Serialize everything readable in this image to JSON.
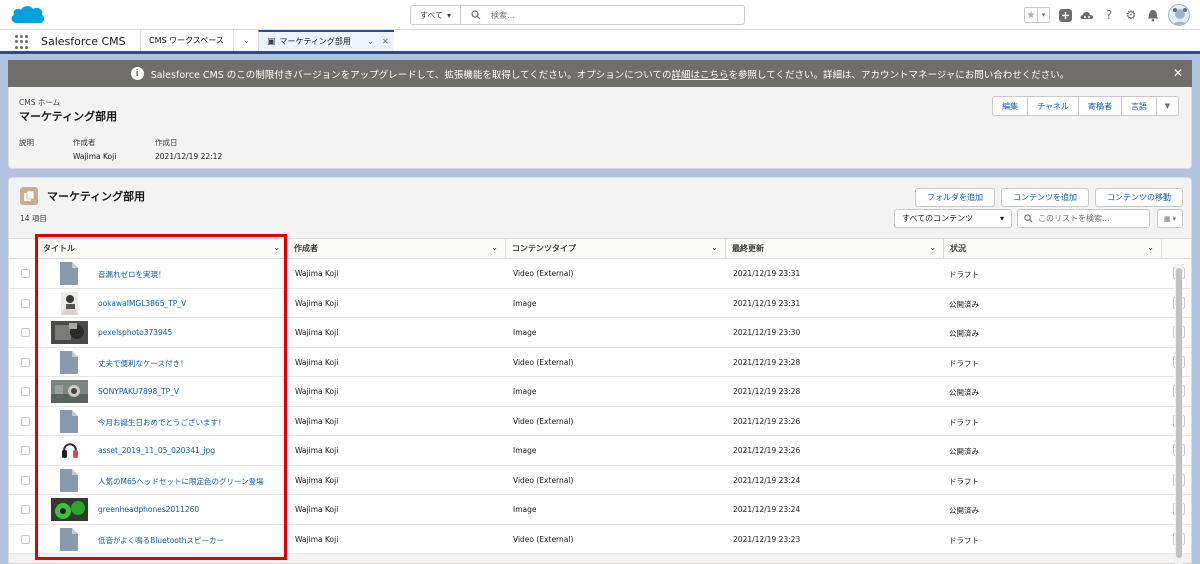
{
  "header": {
    "search_scope": "すべて",
    "search_placeholder": "検索...",
    "icons": [
      "favorites-star-icon",
      "add-icon",
      "trailhead-icon",
      "help-icon",
      "setup-gear-icon",
      "notifications-bell-icon",
      "user-avatar"
    ]
  },
  "nav": {
    "app_name": "Salesforce CMS",
    "workspace_tab": "CMS ワークスペース",
    "active_tab": "マーケティング部用"
  },
  "banner": {
    "text_before": "Salesforce CMS のこの制限付きバージョンをアップグレードして、拡張機能を取得してください。オプションについての",
    "link": "詳細はこちら",
    "text_after": "を参照してください。詳細は、アカウントマネージャにお問い合わせください。"
  },
  "page_header": {
    "breadcrumb": "CMS ホーム",
    "title": "マーケティング部用",
    "buttons": [
      "編集",
      "チャネル",
      "寄稿者",
      "言語"
    ],
    "fields": [
      {
        "label": "説明",
        "value": ""
      },
      {
        "label": "作成者",
        "value": "Wajima Koji"
      },
      {
        "label": "作成日",
        "value": "2021/12/19 22:12"
      }
    ]
  },
  "list": {
    "title": "マーケティング部用",
    "count": "14 項目",
    "actions": [
      "フォルダを追加",
      "コンテンツを追加",
      "コンテンツの移動"
    ],
    "filter": "すべてのコンテンツ",
    "search_placeholder": "このリストを検索...",
    "columns": [
      "タイトル",
      "作成者",
      "コンテンツタイプ",
      "最終更新",
      "状況"
    ],
    "rows": [
      {
        "title": "音漏れゼロを実現！",
        "author": "Wajima Koji",
        "type": "Video (External)",
        "updated": "2021/12/19 23:31",
        "status": "ドラフト",
        "thumb": "doc"
      },
      {
        "title": "ookawaIMGL3865_TP_V",
        "author": "Wajima Koji",
        "type": "Image",
        "updated": "2021/12/19 23:31",
        "status": "公開済み",
        "thumb": "photo-person"
      },
      {
        "title": "pexelsphoto373945",
        "author": "Wajima Koji",
        "type": "Image",
        "updated": "2021/12/19 23:30",
        "status": "公開済み",
        "thumb": "photo-dark"
      },
      {
        "title": "丈夫で便利なケース付き！",
        "author": "Wajima Koji",
        "type": "Video (External)",
        "updated": "2021/12/19 23:28",
        "status": "ドラフト",
        "thumb": "doc"
      },
      {
        "title": "SONYPAKU7898_TP_V",
        "author": "Wajima Koji",
        "type": "Image",
        "updated": "2021/12/19 23:28",
        "status": "公開済み",
        "thumb": "photo-grey"
      },
      {
        "title": "今月お誕生日おめでとうございます！",
        "author": "Wajima Koji",
        "type": "Video (External)",
        "updated": "2021/12/19 23:26",
        "status": "ドラフト",
        "thumb": "doc"
      },
      {
        "title": "asset_2019_11_05_020341_jpg",
        "author": "Wajima Koji",
        "type": "Image",
        "updated": "2021/12/19 23:26",
        "status": "公開済み",
        "thumb": "photo-headphone"
      },
      {
        "title": "人気のM65ヘッドセットに限定色のグリーン登場",
        "author": "Wajima Koji",
        "type": "Video (External)",
        "updated": "2021/12/19 23:24",
        "status": "ドラフト",
        "thumb": "doc"
      },
      {
        "title": "greenheadphones2011260",
        "author": "Wajima Koji",
        "type": "Image",
        "updated": "2021/12/19 23:24",
        "status": "公開済み",
        "thumb": "photo-green"
      },
      {
        "title": "低音がよく鳴るBluetoothスピーカー",
        "author": "Wajima Koji",
        "type": "Video (External)",
        "updated": "2021/12/19 23:23",
        "status": "ドラフト",
        "thumb": "doc"
      }
    ]
  },
  "colors": {
    "brand_blue": "#1b5297",
    "link_blue": "#0b5cab",
    "banner_grey": "#706e6b",
    "highlight_red": "#e00000",
    "page_background": "#b0c4df"
  }
}
